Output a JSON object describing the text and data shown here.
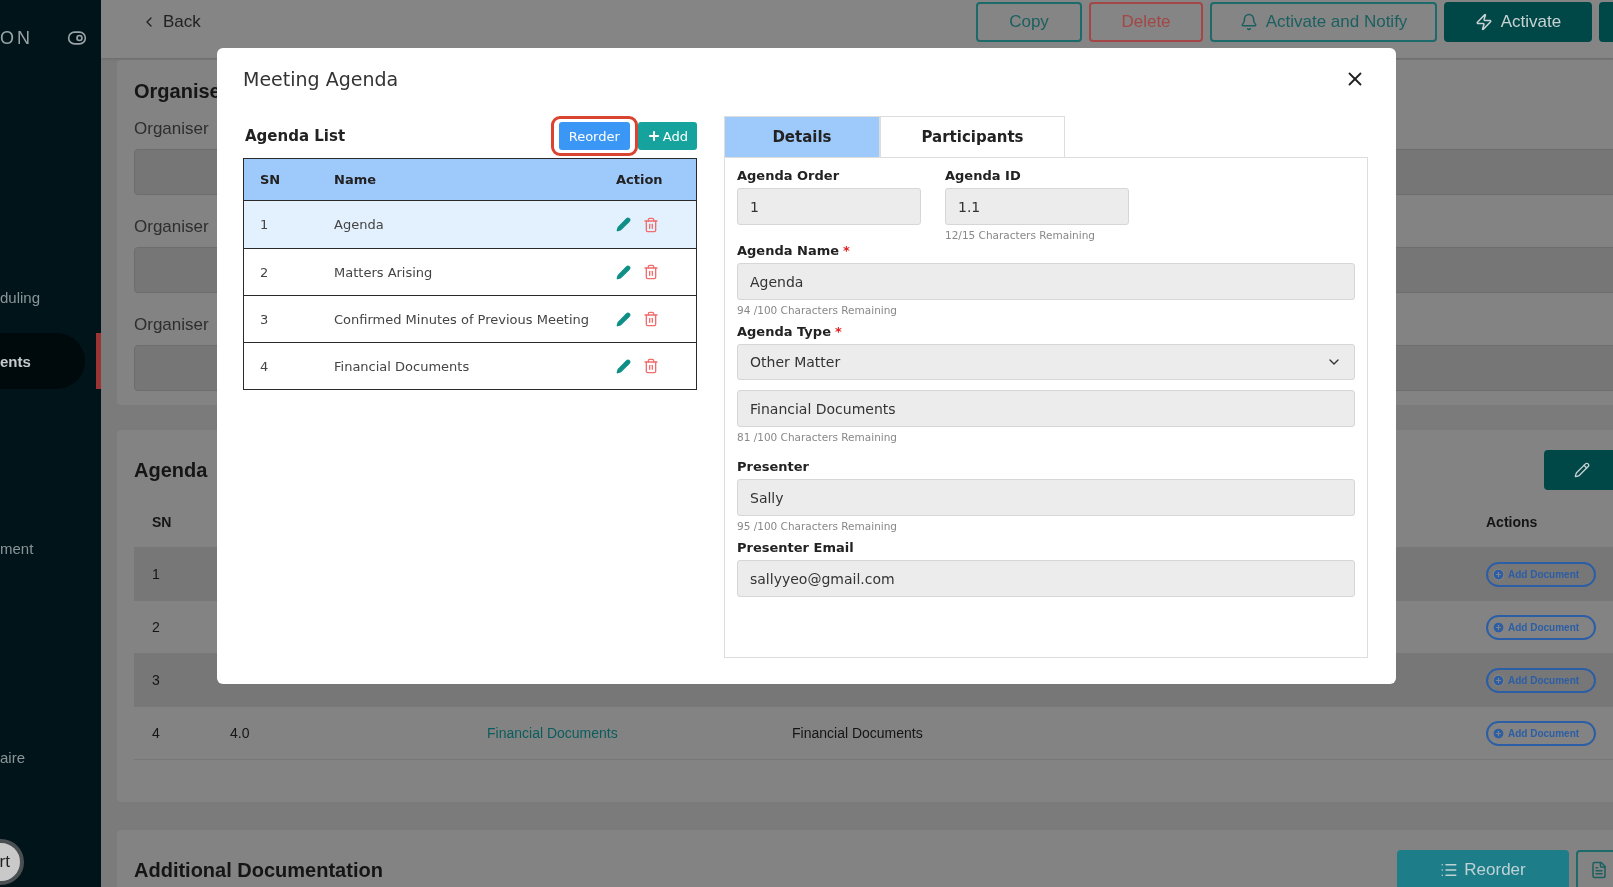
{
  "sidebar": {
    "logo": "ON",
    "items": [
      {
        "label": "duling",
        "selected": false
      },
      {
        "label": "ents",
        "selected": true
      },
      {
        "label": "ment",
        "selected": false
      },
      {
        "label": "aire",
        "selected": false
      }
    ],
    "footer_button": "rt"
  },
  "top_bar": {
    "back": "Back",
    "actions": [
      {
        "label": "Copy",
        "kind": "outline"
      },
      {
        "label": "Delete",
        "kind": "danger"
      },
      {
        "label": "Activate and Notify",
        "kind": "notify"
      },
      {
        "label": "Activate",
        "kind": "activate"
      },
      {
        "kind": "blank"
      }
    ]
  },
  "organiser_section": {
    "title": "Organise",
    "fields": [
      {
        "label": "Organiser"
      },
      {
        "label": "Organiser"
      },
      {
        "label": "Organiser"
      }
    ]
  },
  "agenda_section": {
    "title": "Agenda",
    "columns": [
      "SN",
      "Actions"
    ],
    "rows": [
      {
        "sn": "1",
        "action": "Add Document"
      },
      {
        "sn": "2",
        "action": "Add Document"
      },
      {
        "sn": "3",
        "action": "Add Document"
      },
      {
        "sn": "4",
        "column_2": "4.0",
        "column_3": "Financial Documents",
        "column_4": "Financial Documents",
        "action": "Add Document"
      }
    ]
  },
  "additional_section": {
    "title": "Additional Documentation",
    "reorder": "Reorder"
  },
  "modal": {
    "title": "Meeting Agenda",
    "agenda_list": {
      "title": "Agenda List",
      "reorder": {
        "label": "Reorder",
        "highlighted": true
      },
      "add": "Add",
      "columns": [
        "SN",
        "Name",
        "Action"
      ],
      "rows": [
        {
          "sn": "1",
          "name": "Agenda",
          "selected": true
        },
        {
          "sn": "2",
          "name": "Matters Arising",
          "selected": false
        },
        {
          "sn": "3",
          "name": "Confirmed Minutes of Previous Meeting",
          "selected": false
        },
        {
          "sn": "4",
          "name": "Financial Documents",
          "selected": false
        }
      ]
    },
    "tabs": [
      {
        "label": "Details",
        "selected": true
      },
      {
        "label": "Participants",
        "selected": false
      }
    ],
    "form": {
      "agenda_order": {
        "label": "Agenda Order",
        "value": "1"
      },
      "agenda_id": {
        "label": "Agenda ID",
        "value": "1.1",
        "hint": "12/15 Characters Remaining"
      },
      "agenda_name": {
        "label": "Agenda Name",
        "required_mark": "*",
        "value": "Agenda",
        "hint": "94 /100 Characters Remaining"
      },
      "agenda_type": {
        "label": "Agenda Type",
        "required_mark": "*",
        "value": "Other Matter"
      },
      "agenda_type_detail": {
        "value": "Financial Documents",
        "hint": "81 /100 Characters Remaining"
      },
      "presenter": {
        "label": "Presenter",
        "value": "Sally",
        "hint": "95 /100 Characters Remaining"
      },
      "presenter_email": {
        "label": "Presenter Email",
        "value": "sallyyeo@gmail.com"
      }
    }
  }
}
